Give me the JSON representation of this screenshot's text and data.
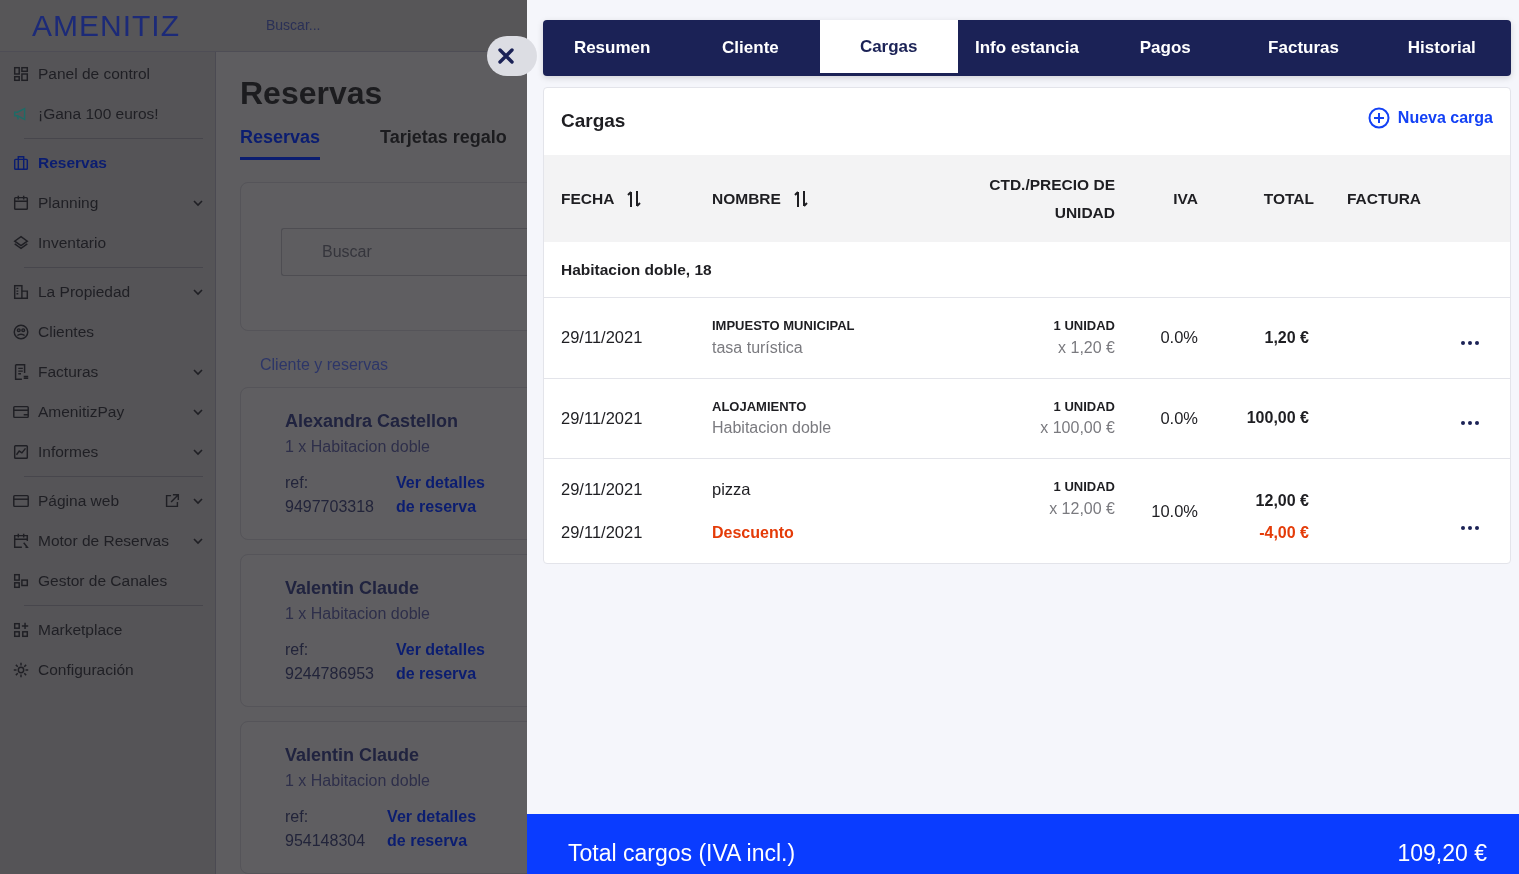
{
  "app": {
    "logo": "AMENITIZ",
    "search_placeholder": "Buscar..."
  },
  "sidebar": {
    "sections": [
      {
        "items": [
          {
            "label": "Panel de control",
            "selected": false,
            "expandable": false
          },
          {
            "label": "¡Gana 100 euros!",
            "selected": false,
            "expandable": false
          }
        ]
      },
      {
        "items": [
          {
            "label": "Reservas",
            "selected": true,
            "expandable": false
          },
          {
            "label": "Planning",
            "selected": false,
            "expandable": true
          },
          {
            "label": "Inventario",
            "selected": false,
            "expandable": false
          }
        ]
      },
      {
        "items": [
          {
            "label": "La Propiedad",
            "selected": false,
            "expandable": true
          },
          {
            "label": "Clientes",
            "selected": false,
            "expandable": false
          },
          {
            "label": "Facturas",
            "selected": false,
            "expandable": true
          },
          {
            "label": "AmenitizPay",
            "selected": false,
            "expandable": true
          },
          {
            "label": "Informes",
            "selected": false,
            "expandable": true
          }
        ]
      },
      {
        "items": [
          {
            "label": "Página web",
            "selected": false,
            "expandable": true,
            "external": true
          },
          {
            "label": "Motor de Reservas",
            "selected": false,
            "expandable": true
          },
          {
            "label": "Gestor de Canales",
            "selected": false,
            "expandable": false
          }
        ]
      },
      {
        "items": [
          {
            "label": "Marketplace",
            "selected": false,
            "expandable": false
          },
          {
            "label": "Configuración",
            "selected": false,
            "expandable": false
          }
        ]
      }
    ]
  },
  "page": {
    "title": "Reservas",
    "tabs": [
      {
        "label": "Reservas",
        "selected": true
      },
      {
        "label": "Tarjetas regalo",
        "selected": false
      }
    ],
    "search_placeholder": "Buscar",
    "section_label": "Cliente y reservas",
    "bookings": [
      {
        "name": "Alexandra Castellon",
        "room": "1 x Habitacion doble",
        "ref_label": "ref:",
        "ref": "9497703318",
        "link": "Ver detalles de reserva"
      },
      {
        "name": "Valentin Claude",
        "room": "1 x Habitacion doble",
        "ref_label": "ref:",
        "ref": "9244786953",
        "link": "Ver detalles de reserva"
      },
      {
        "name": "Valentin Claude",
        "room": "1 x Habitacion doble",
        "ref_label": "ref:",
        "ref": "954148304",
        "link": "Ver detalles de reserva"
      }
    ]
  },
  "drawer": {
    "tabs": [
      {
        "label": "Resumen",
        "selected": false
      },
      {
        "label": "Cliente",
        "selected": false
      },
      {
        "label": "Cargas",
        "selected": true
      },
      {
        "label": "Info estancia",
        "selected": false
      },
      {
        "label": "Pagos",
        "selected": false
      },
      {
        "label": "Facturas",
        "selected": false
      },
      {
        "label": "Historial",
        "selected": false
      }
    ],
    "card_title": "Cargas",
    "new_button": "Nueva carga",
    "columns": [
      {
        "label": "FECHA",
        "sortable": true
      },
      {
        "label": "NOMBRE",
        "sortable": true
      },
      {
        "label": "CTD./PRECIO DE UNIDAD",
        "sortable": false
      },
      {
        "label": "IVA",
        "sortable": false
      },
      {
        "label": "TOTAL",
        "sortable": false
      },
      {
        "label": "FACTURA",
        "sortable": false
      }
    ],
    "group": "Habitacion doble, 18",
    "rows": [
      {
        "date": "29/11/2021",
        "name": "IMPUESTO MUNICIPAL",
        "caps": true,
        "description": "tasa turística",
        "qty": "1 UNIDAD",
        "price": "x 1,20 €",
        "vat": "0.0%",
        "total": "1,20 €"
      },
      {
        "date": "29/11/2021",
        "name": "ALOJAMIENTO",
        "caps": true,
        "description": "Habitacion doble",
        "qty": "1 UNIDAD",
        "price": "x 100,00 €",
        "vat": "0.0%",
        "total": "100,00 €"
      },
      {
        "date": "29/11/2021",
        "name": "pizza",
        "caps": false,
        "qty": "1 UNIDAD",
        "price": "x 12,00 €",
        "vat": "10.0%",
        "total": "12,00 €",
        "discount": {
          "date": "29/11/2021",
          "name": "Descuento",
          "amount": "-4,00 €"
        }
      }
    ]
  },
  "footer": {
    "label": "Total cargos (IVA incl.)",
    "amount": "109,20 €"
  }
}
